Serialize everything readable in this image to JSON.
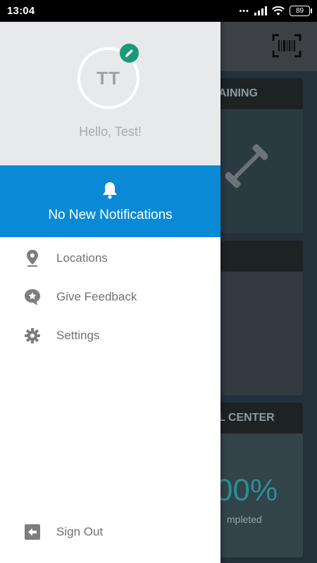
{
  "status_bar": {
    "time": "13:04",
    "signal_dots": "•••",
    "battery": "89"
  },
  "background": {
    "cards": [
      {
        "title": "AINING"
      },
      {
        "title": ""
      },
      {
        "title": "L CENTER",
        "percent": "00%",
        "caption": "mpleted"
      }
    ]
  },
  "drawer": {
    "avatar_initials": "TT",
    "greeting": "Hello, Test!",
    "notifications_label": "No New Notifications",
    "menu": [
      {
        "label": "Locations",
        "icon": "location-pin-icon"
      },
      {
        "label": "Give Feedback",
        "icon": "feedback-icon"
      },
      {
        "label": "Settings",
        "icon": "gear-icon"
      }
    ],
    "sign_out_label": "Sign Out"
  },
  "colors": {
    "accent": "#0a8ad6",
    "edit_badge": "#1a9a7a",
    "header_bg": "#e8e9eb"
  }
}
